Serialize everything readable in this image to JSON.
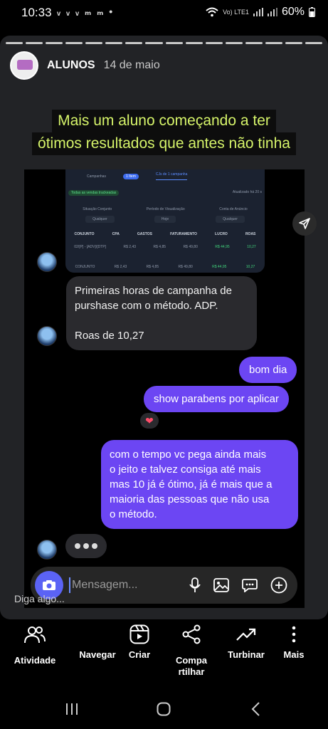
{
  "status_bar": {
    "time": "10:33",
    "notifications": "ᵥ ᵥ ᵥ ₘ ₘ •",
    "network": "Vo) LTE1",
    "battery": "60%"
  },
  "story": {
    "user": "ALUNOS",
    "date": "14 de maio",
    "caption_line1": "Mais um aluno começando a ter",
    "caption_line2": "ótimos resultados que antes não tinha"
  },
  "dashboard": {
    "tab1": "Campanhas",
    "badge": "1 Item",
    "tab2": "CJs de 1 campanha",
    "pill": "Todas as vendas trackeadas",
    "updated": "Atualizado há 20 s",
    "filters": [
      "Situação Conjunto",
      "Período de Visualização",
      "Conta de Anúncio"
    ],
    "selects": [
      "Qualquer",
      "Hoje",
      "Qualquer"
    ],
    "headers": [
      "CONJUNTO",
      "CPA",
      "GASTOS",
      "FATURAMENTO",
      "LUCRO",
      "ROAS"
    ],
    "row1": [
      "02/[P] - [ADV]/[DTP]",
      "R$ 2,43",
      "R$ 4,85",
      "R$ 49,80",
      "R$ 44,95",
      "10,27"
    ],
    "row2": [
      "CONJUNTO",
      "R$ 2,43",
      "R$ 4,85",
      "R$ 49,80",
      "R$ 44,95",
      "10,27"
    ]
  },
  "messages": {
    "in1_line1": "Primeiras horas de campanha de",
    "in1_line2": "purshase com o método. ADP.",
    "in1_line3": "Roas de 10,27",
    "out1": "bom dia",
    "out2": "show parabens por aplicar",
    "reaction": "❤",
    "out3_line1": "com o tempo vc pega ainda mais",
    "out3_line2": "o jeito e talvez consiga até mais",
    "out3_line3": "mas 10 já é ótimo, já é mais que a",
    "out3_line4": "maioria das pessoas que não usa",
    "out3_line5": "o método."
  },
  "composer": {
    "placeholder": "Mensagem..."
  },
  "reply_hint": "Diga algo...",
  "actions": {
    "activity": "Atividade",
    "navigate": "Navegar",
    "create": "Criar",
    "share_line1": "Compa",
    "share_line2": "rtilhar",
    "boost": "Turbinar",
    "more": "Mais"
  },
  "colors": {
    "caption_text": "#d6f46a",
    "outgoing_bubble": "#6c46f3",
    "incoming_bubble": "#2a2a2e",
    "camera_button": "#5b63f5"
  }
}
